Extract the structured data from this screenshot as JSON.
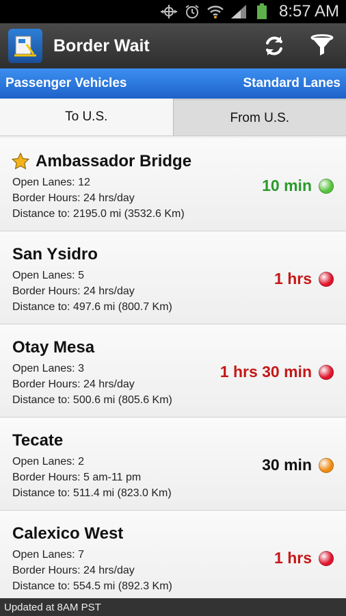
{
  "status": {
    "time": "8:57 AM"
  },
  "app": {
    "title": "Border Wait"
  },
  "filters": {
    "vehicle_type": "Passenger Vehicles",
    "lane_type": "Standard Lanes"
  },
  "tabs": [
    {
      "label": "To U.S.",
      "active": true
    },
    {
      "label": "From U.S.",
      "active": false
    }
  ],
  "crossings": [
    {
      "name": "Ambassador Bridge",
      "favorite": true,
      "open_lanes": "Open Lanes: 12",
      "hours": "Border Hours: 24 hrs/day",
      "distance": "Distance to: 2195.0 mi (3532.6 Km)",
      "wait": "10 min",
      "wait_color": "#2a9a2a",
      "dot_color": "#56c23a"
    },
    {
      "name": "San Ysidro",
      "favorite": false,
      "open_lanes": "Open Lanes: 5",
      "hours": "Border Hours: 24 hrs/day",
      "distance": "Distance to: 497.6 mi (800.7 Km)",
      "wait": "1 hrs",
      "wait_color": "#c41818",
      "dot_color": "#e0142c"
    },
    {
      "name": "Otay Mesa",
      "favorite": false,
      "open_lanes": "Open Lanes: 3",
      "hours": "Border Hours: 24 hrs/day",
      "distance": "Distance to: 500.6 mi (805.6 Km)",
      "wait": "1 hrs 30 min",
      "wait_color": "#c41818",
      "dot_color": "#e0142c"
    },
    {
      "name": "Tecate",
      "favorite": false,
      "open_lanes": "Open Lanes: 2",
      "hours": "Border Hours: 5 am-11 pm",
      "distance": "Distance to: 511.4 mi (823.0 Km)",
      "wait": "30 min",
      "wait_color": "#111111",
      "dot_color": "#f08a10"
    },
    {
      "name": "Calexico West",
      "favorite": false,
      "open_lanes": "Open Lanes: 7",
      "hours": "Border Hours: 24 hrs/day",
      "distance": "Distance to: 554.5 mi (892.3 Km)",
      "wait": "1 hrs",
      "wait_color": "#c41818",
      "dot_color": "#e0142c"
    }
  ],
  "footer": {
    "updated": "Updated at 8AM PST"
  },
  "icons": {
    "refresh": "refresh-icon",
    "filter": "filter-icon",
    "favorite": "star-icon"
  },
  "colors": {
    "accent_blue": "#1e62c9",
    "appbar": "#3a3a3a"
  }
}
